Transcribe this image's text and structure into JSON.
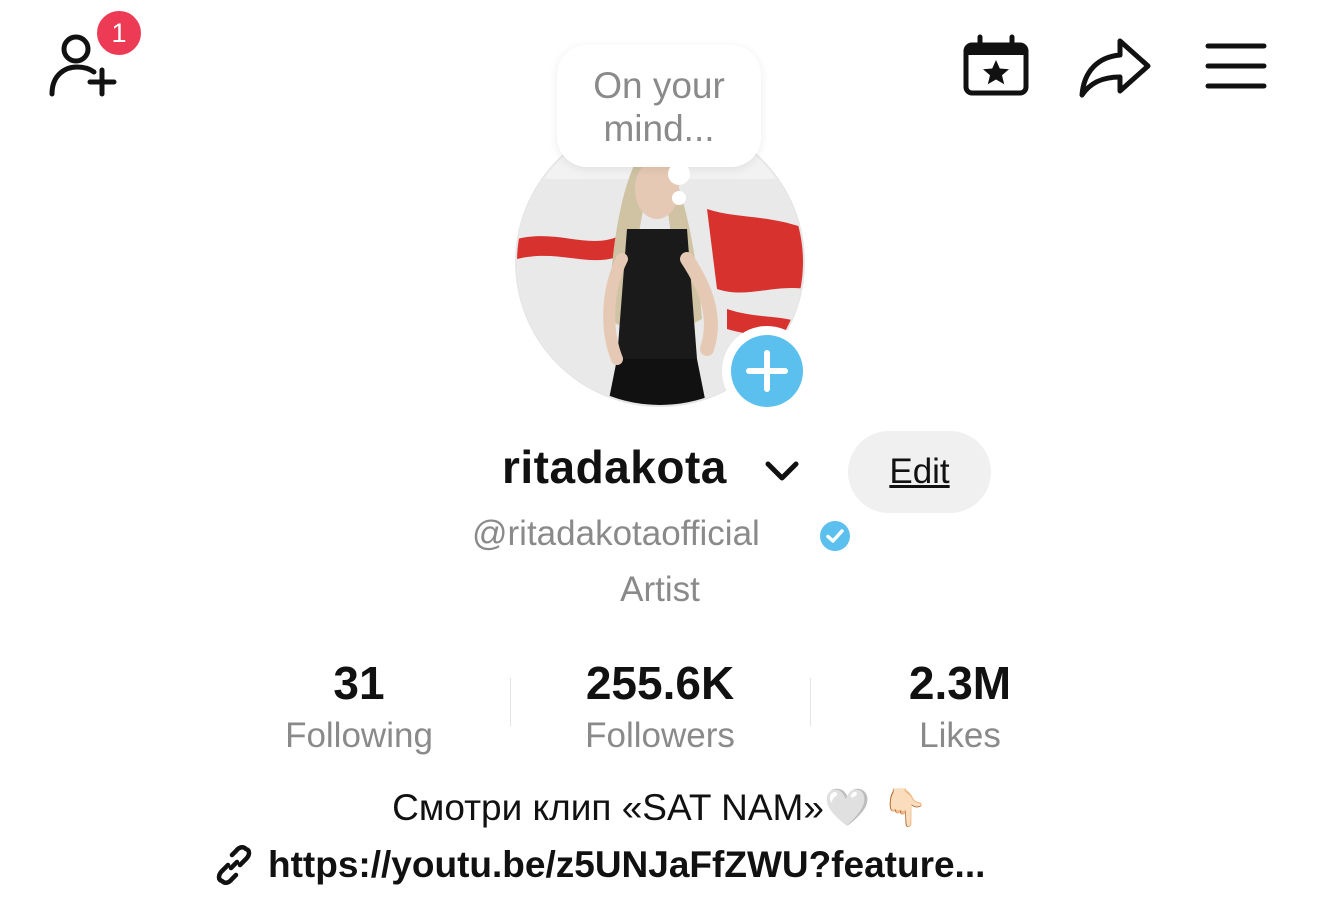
{
  "header": {
    "add_friends_icon": "person-plus-icon",
    "notification_count": "1",
    "calendar_icon": "calendar-star-icon",
    "share_icon": "share-arrow-icon",
    "menu_icon": "hamburger-menu-icon"
  },
  "avatar": {
    "thought_bubble": "On your mind...",
    "add_icon": "plus-icon"
  },
  "profile": {
    "username": "ritadakota",
    "edit_label": "Edit",
    "handle": "@ritadakotaofficial",
    "verified_icon": "verified-check-icon",
    "category": "Artist"
  },
  "stats": [
    {
      "value": "31",
      "label": "Following"
    },
    {
      "value": "255.6K",
      "label": "Followers"
    },
    {
      "value": "2.3M",
      "label": "Likes"
    }
  ],
  "bio": {
    "text": "Смотри клип «SAT NAM»",
    "emoji": "🤍 👇🏻",
    "link": "https://youtu.be/z5UNJaFfZWU?feature..."
  },
  "colors": {
    "badge": "#ee3b55",
    "accent_blue": "#5bc0ee",
    "secondary_text": "#8a8a8a",
    "edit_button_bg": "#f0f0f0"
  }
}
